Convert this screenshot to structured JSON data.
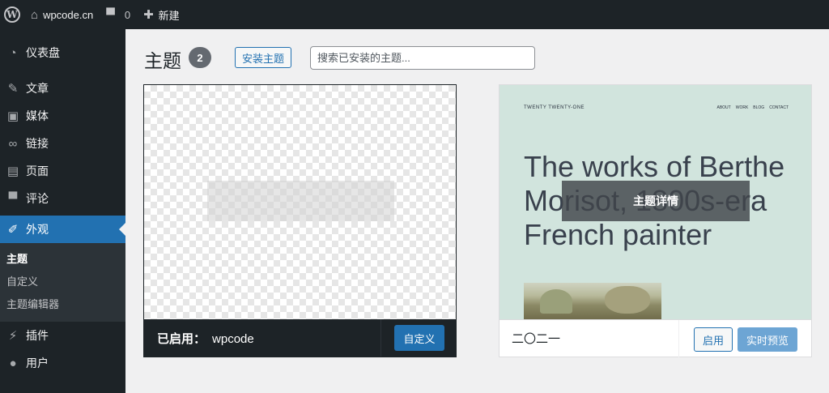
{
  "adminbar": {
    "logo_icon": "wordpress-logo-icon",
    "site_name": "wpcode.cn",
    "comments_count": "0",
    "new_label": "新建"
  },
  "sidebar": {
    "items": [
      {
        "label": "仪表盘",
        "icon": "dashboard-icon"
      },
      {
        "label": "文章",
        "icon": "pin-icon"
      },
      {
        "label": "媒体",
        "icon": "media-icon"
      },
      {
        "label": "链接",
        "icon": "link-icon"
      },
      {
        "label": "页面",
        "icon": "page-icon"
      },
      {
        "label": "评论",
        "icon": "comment-icon"
      },
      {
        "label": "外观",
        "icon": "brush-icon"
      },
      {
        "label": "插件",
        "icon": "plugin-icon"
      },
      {
        "label": "用户",
        "icon": "user-icon"
      }
    ],
    "submenu": [
      "主题",
      "自定义",
      "主题编辑器"
    ]
  },
  "main": {
    "title": "主题",
    "count": "2",
    "install_label": "安装主题",
    "search_placeholder": "搜索已安装的主题..."
  },
  "themes": {
    "active": {
      "prefix": "已启用：",
      "name": "wpcode",
      "customize_label": "自定义"
    },
    "other": {
      "name": "二〇二一",
      "details_label": "主题详情",
      "activate_label": "启用",
      "preview_label": "实时预览",
      "screenshot": {
        "site_title": "TWENTY TWENTY-ONE",
        "nav": [
          "ABOUT",
          "WORK",
          "BLOG",
          "CONTACT"
        ],
        "headline": "The works of Berthe Morisot, 1800s-era French painter"
      }
    }
  },
  "colors": {
    "admin_dark": "#1d2327",
    "accent": "#2271b1",
    "theme_bg": "#d1e4dd"
  }
}
